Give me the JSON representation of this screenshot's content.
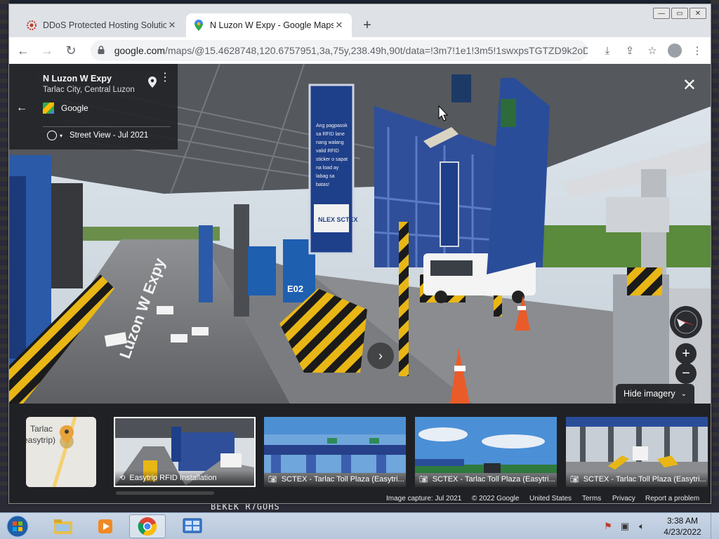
{
  "browser": {
    "tabs": [
      {
        "title": "DDoS Protected Hosting Solution",
        "active": false
      },
      {
        "title": "N Luzon W Expy - Google Maps",
        "active": true
      }
    ],
    "url_host": "google.com",
    "url_path": "/maps/@15.4628748,120.6757951,3a,75y,238.49h,90t/data=!3m7!1e1!3m5!1swxpsTGTZD9k2oD..."
  },
  "streetview": {
    "place_title": "N Luzon W Expy",
    "place_subtitle": "Tarlac City, Central Luzon",
    "source": "Google",
    "date_label": "Street View - Jul 2021",
    "hide_imagery_label": "Hide imagery"
  },
  "filmstrip": {
    "map_label_1": "Tarlac",
    "map_label_2": "easytrip)",
    "items": [
      {
        "caption": "Easytrip RFID Installation",
        "icon": "360-icon"
      },
      {
        "caption": "SCTEX - Tarlac Toll Plaza (Easytri...",
        "icon": "camera-icon"
      },
      {
        "caption": "SCTEX - Tarlac Toll Plaza (Easytri...",
        "icon": "camera-icon"
      },
      {
        "caption": "SCTEX - Tarlac Toll Plaza (Easytri...",
        "icon": "camera-icon"
      }
    ]
  },
  "footer": {
    "capture": "Image capture: Jul 2021",
    "copyright": "© 2022 Google",
    "region": "United States",
    "terms": "Terms",
    "privacy": "Privacy",
    "report": "Report a problem"
  },
  "taskbar": {
    "time": "3:38 AM",
    "date": "4/23/2022"
  },
  "desktop": {
    "bottom_text": "BEKEK R7GOHS"
  }
}
